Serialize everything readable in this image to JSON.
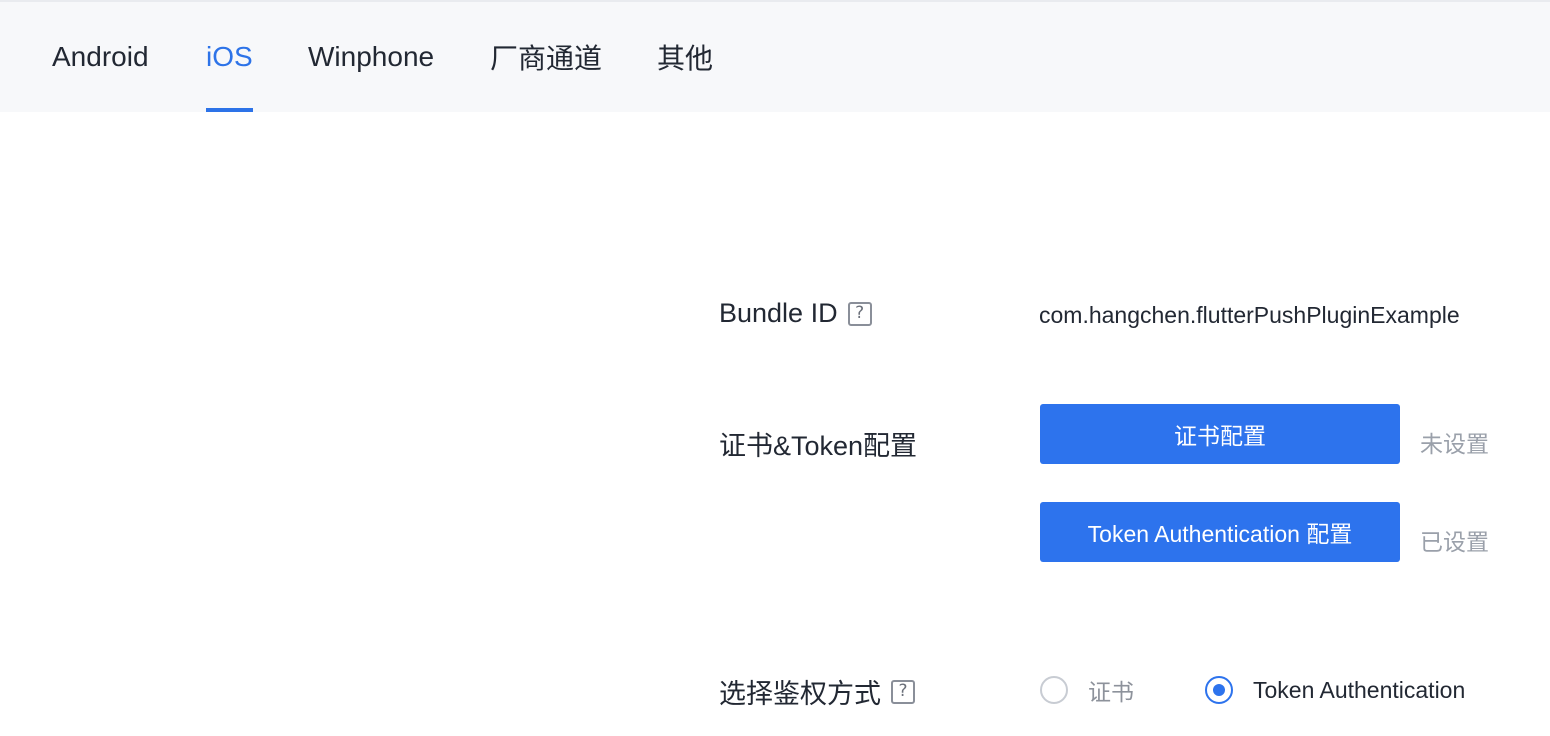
{
  "tabs": [
    {
      "id": "android",
      "label": "Android",
      "active": false
    },
    {
      "id": "ios",
      "label": "iOS",
      "active": true
    },
    {
      "id": "winphone",
      "label": "Winphone",
      "active": false
    },
    {
      "id": "vendor",
      "label": "厂商通道",
      "active": false
    },
    {
      "id": "other",
      "label": "其他",
      "active": false
    }
  ],
  "bundle": {
    "label": "Bundle ID",
    "help_icon": "question-mark-icon",
    "value": "com.hangchen.flutterPushPluginExample"
  },
  "cert_token": {
    "label": "证书&Token配置",
    "cert_button": "证书配置",
    "cert_status": "未设置",
    "token_button": "Token Authentication 配置",
    "token_status": "已设置"
  },
  "auth_method": {
    "label": "选择鉴权方式",
    "help_icon": "question-mark-icon",
    "options": [
      {
        "label": "证书",
        "checked": false
      },
      {
        "label": "Token Authentication",
        "checked": true
      }
    ]
  },
  "colors": {
    "accent": "#2d73ed",
    "tabbar_bg": "#f7f8fa",
    "muted_text": "#9aa0aa"
  }
}
